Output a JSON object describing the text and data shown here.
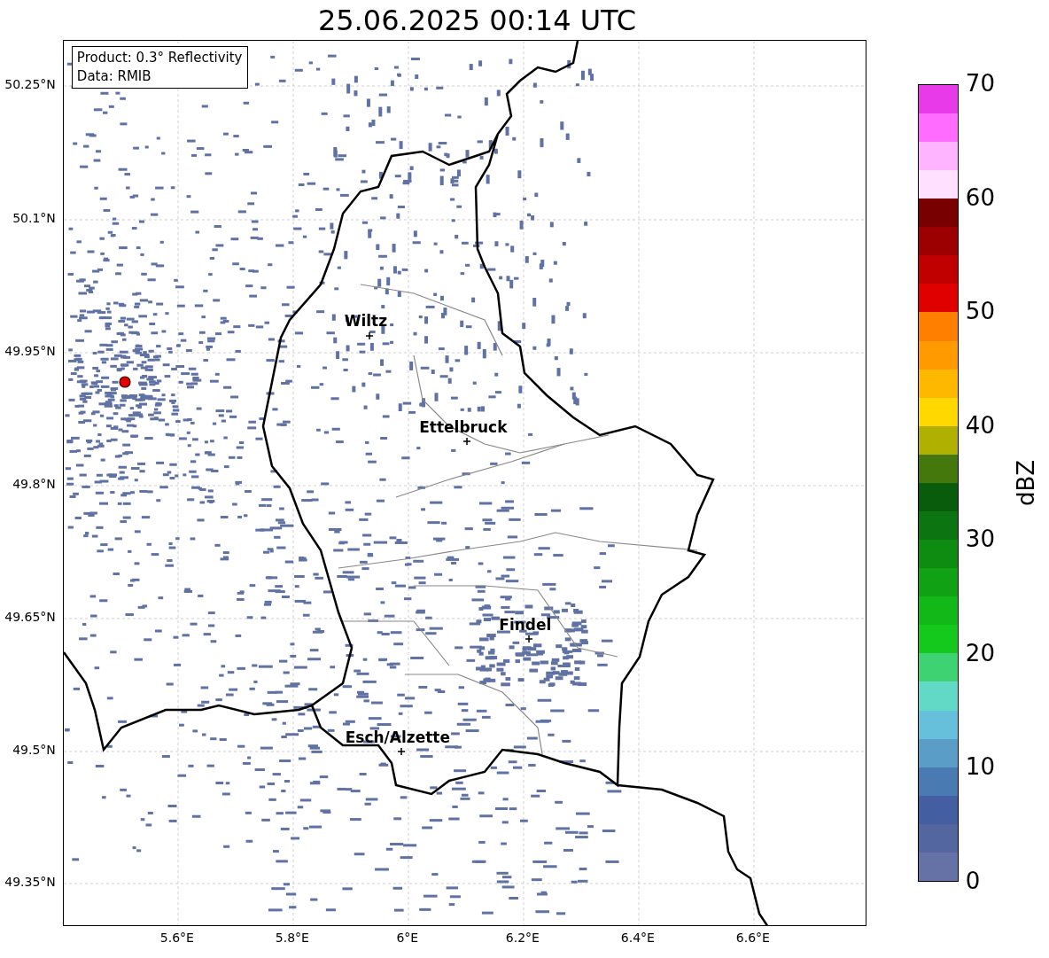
{
  "title": "25.06.2025 00:14 UTC",
  "info_box": {
    "lines": [
      "Product: 0.3° Reflectivity",
      "Data: RMIB"
    ]
  },
  "cities": [
    {
      "name": "Wiltz"
    },
    {
      "name": "Ettelbruck"
    },
    {
      "name": "Findel"
    },
    {
      "name": "Esch/Alzette"
    }
  ],
  "x_ticks": [
    "5.6°E",
    "5.8°E",
    "6°E",
    "6.2°E",
    "6.4°E",
    "6.6°E"
  ],
  "y_ticks": [
    "50.25°N",
    "50.1°N",
    "49.95°N",
    "49.8°N",
    "49.65°N",
    "49.5°N",
    "49.35°N"
  ],
  "colorbar": {
    "label": "dBZ",
    "ticks": [
      "70",
      "60",
      "50",
      "40",
      "30",
      "20",
      "10",
      "0"
    ],
    "segments": [
      {
        "color": "#6472a6"
      },
      {
        "color": "#5466a0"
      },
      {
        "color": "#445ea2"
      },
      {
        "color": "#4a7ab2"
      },
      {
        "color": "#5a9ec8"
      },
      {
        "color": "#66c0dc"
      },
      {
        "color": "#62d8c6"
      },
      {
        "color": "#3ed272"
      },
      {
        "color": "#14c81c"
      },
      {
        "color": "#12b818"
      },
      {
        "color": "#10a214"
      },
      {
        "color": "#0e8c12"
      },
      {
        "color": "#0c7410"
      },
      {
        "color": "#085c0c"
      },
      {
        "color": "#44780c"
      },
      {
        "color": "#b0b000"
      },
      {
        "color": "#ffd800"
      },
      {
        "color": "#ffb800"
      },
      {
        "color": "#ff9a00"
      },
      {
        "color": "#ff8000"
      },
      {
        "color": "#e00000"
      },
      {
        "color": "#c00000"
      },
      {
        "color": "#9c0000"
      },
      {
        "color": "#780000"
      },
      {
        "color": "#ffe0ff"
      },
      {
        "color": "#ffb4ff"
      },
      {
        "color": "#ff6cff"
      },
      {
        "color": "#e83ae8"
      }
    ]
  }
}
